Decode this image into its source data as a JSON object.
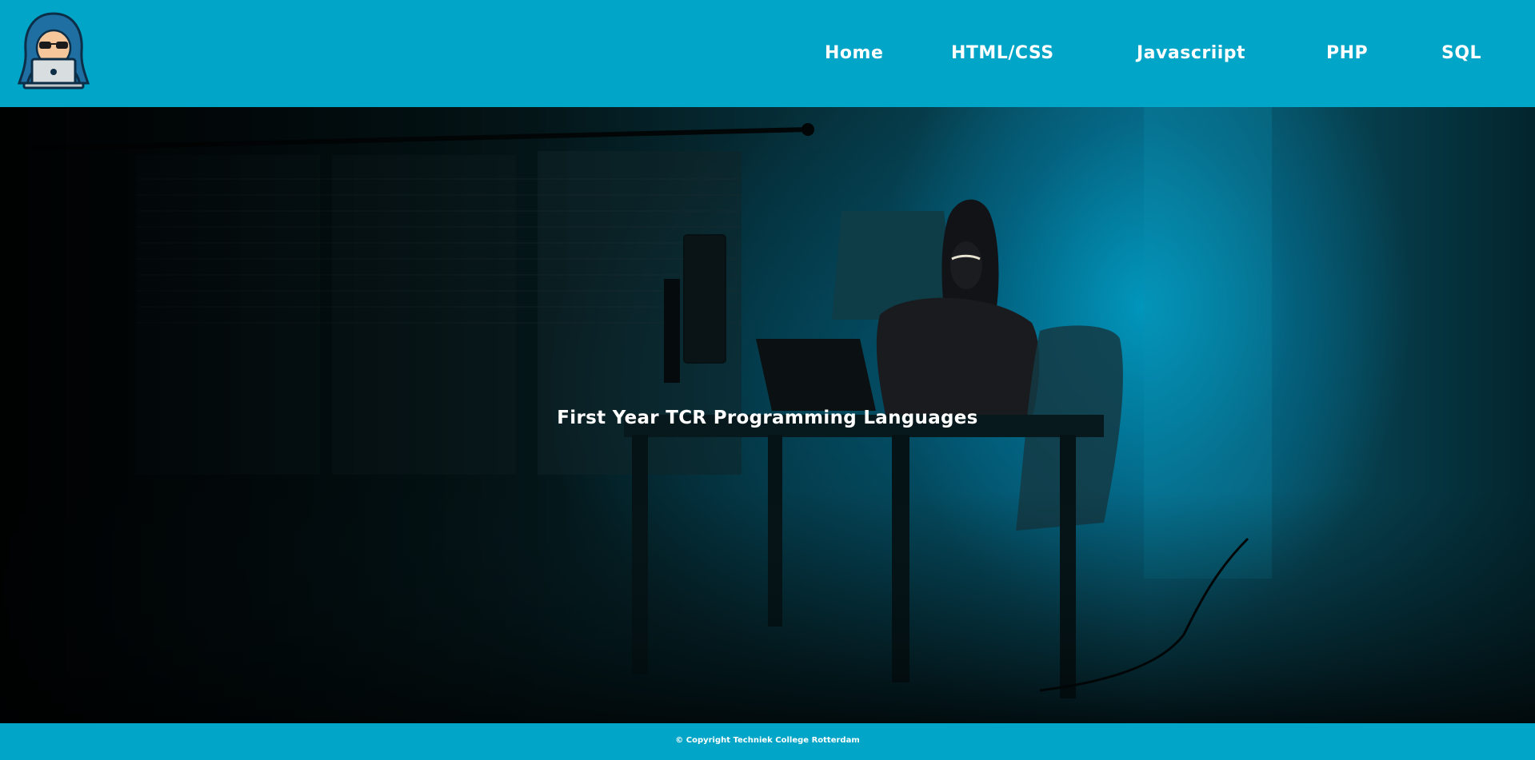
{
  "header": {
    "logo_icon": "hacker-with-laptop-icon",
    "nav": [
      {
        "label": "Home"
      },
      {
        "label": "HTML/CSS"
      },
      {
        "label": "Javascriipt"
      },
      {
        "label": "PHP"
      },
      {
        "label": "SQL"
      }
    ]
  },
  "hero": {
    "title": "First Year TCR Programming Languages"
  },
  "footer": {
    "copyright": "© Copyright Techniek College Rotterdam"
  },
  "colors": {
    "brand": "#00a5c8",
    "text": "#ffffff"
  }
}
